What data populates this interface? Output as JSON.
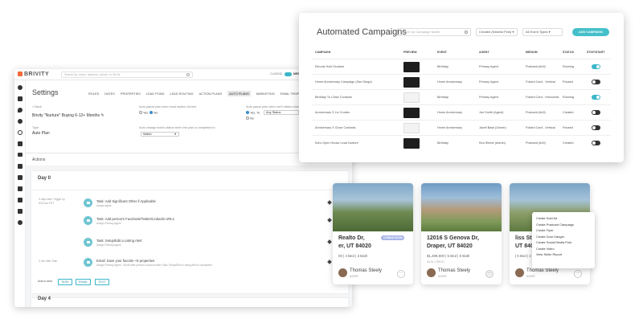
{
  "settings": {
    "brand": "BRIVITY",
    "search_placeholder": "Search by: name, address, phone, or MLS#",
    "classic_label": "CLASSIC",
    "new_label": "NEW",
    "page_title": "Settings",
    "nav": [
      "ROLES",
      "DATES",
      "PROPERTIES",
      "LEAD POND",
      "LEAD ROUTING",
      "ACTION PLANS",
      "AUTO PLANS",
      "MARKETING",
      "EMAIL TEMPLATES"
    ],
    "active_nav": "AUTO PLANS",
    "back": "< Back",
    "plan_name": "Brivity \"Nurture\" Buying 6-12+ Months",
    "type_label": "Type",
    "type_value": "Auto Plan",
    "pause_label": "Auto pause plan when lead replies via text",
    "pause_yes": "Yes",
    "pause_no": "No",
    "pause2_label": "Auto pause plan when we'll status chan",
    "pause2_yes": "Yes, To",
    "pause2_no": "No",
    "pause2_select": "Any Status",
    "change_label": "Auto change lead's status when the plan is completed to",
    "change_value": "Watch",
    "actions_label": "Actions",
    "day0": "Day 0",
    "day4": "Day 4",
    "add_new": "Add a new",
    "add_buttons": [
      "TASK",
      "EMAIL",
      "TEXT"
    ],
    "tasks": [
      {
        "when": "9 days after Trigger by 8/23 am PST",
        "title": "Task: Add Significant Other if Applicable",
        "sub": "Assign agent"
      },
      {
        "when": "",
        "title": "Task: Add person's Facebook/Twitter/LinkedIn URLs",
        "sub": "Assign Primary Agent"
      },
      {
        "when": "",
        "title": "Task: Setup/Edit a Listing Alert",
        "sub": "Assign Primary Agent"
      },
      {
        "when": "3 min after Task",
        "title": "Email: Save your favorite +5 properties",
        "sub": "Assign Primary Agent · Email after person's Account after Task: Setup/Edit a Listing Alert is completed"
      }
    ]
  },
  "cards": [
    {
      "addr1": "Realto Dr,",
      "addr2": "er, UT 84020",
      "facts": "00 | 4 Bed | 3 Bath",
      "mls": "",
      "agent": "Thomas Steely",
      "agent_sub": "AGENT",
      "badge": "COMING SOON",
      "badge_color": "#a9b6e8"
    },
    {
      "addr1": "12016 S Genova Dr,",
      "addr2": "Draper, UT 84020",
      "facts": "$1,499,900 | 5 Bed | 5 Bath",
      "mls": "MLS# 1789032",
      "agent": "Thomas Steely",
      "agent_sub": "AGENT",
      "badge": "",
      "badge_color": ""
    },
    {
      "addr1": "liss St,",
      "addr2": "UT 84020",
      "facts": "| 5 Bed | 2 Bath",
      "mls": "",
      "agent": "Thomas Steely",
      "agent_sub": "AGENT",
      "badge": "PENDING",
      "badge_color": "#f3c26b"
    }
  ],
  "menu": [
    "Create Sold Ad",
    "Create Postcard Campaign",
    "Create Flyer",
    "Create Door Hanger",
    "Create Social Media Post",
    "Create Video",
    "View Seller Report"
  ],
  "campaigns": {
    "title": "Automated Campaigns",
    "search_placeholder": "Search by Campaign Name",
    "sort": "Created (Newest First)",
    "event_filter": "All Event Types",
    "add_button": "ADD CAMPAIGN",
    "columns": [
      "CAMPAIGN",
      "PREVIEW",
      "EVENT",
      "AGENT",
      "MEDIUM",
      "STATUS",
      "STOP/START"
    ],
    "rows": [
      {
        "name": "Eleonis Hold Sculture",
        "event": "Birthday",
        "agent": "Primary Agent",
        "medium": "Postcard (6x9)",
        "status": "Running",
        "on": true,
        "light": false
      },
      {
        "name": "Home Anniversary Campaign (San Diego)",
        "event": "Home Anniversary",
        "agent": "Primary Agent",
        "medium": "Folded Card - Vertical",
        "status": "Paused",
        "on": false,
        "light": false
      },
      {
        "name": "Birthday To Close Contacts",
        "event": "Birthday",
        "agent": "Primary Agent",
        "medium": "Folded Card - Horizontal",
        "status": "Running",
        "on": true,
        "light": true
      },
      {
        "name": "Anniversary S Liv Crodes",
        "event": "Home Anniversary",
        "agent": "Jon Smith (Agent)",
        "medium": "Postcard (6x9)",
        "status": "Created",
        "on": false,
        "light": false
      },
      {
        "name": "Anniversary X Close Contacts",
        "event": "Home Anniversary",
        "agent": "Jacell Basil (Owner)",
        "medium": "Folded Card - Vertical",
        "status": "Paused",
        "on": false,
        "light": true
      },
      {
        "name": "Kia's Open House Lead Nurture",
        "event": "Birthday",
        "agent": "Kira Steele (Admin)",
        "medium": "Postcard (6x9)",
        "status": "Created",
        "on": false,
        "light": false
      }
    ]
  }
}
